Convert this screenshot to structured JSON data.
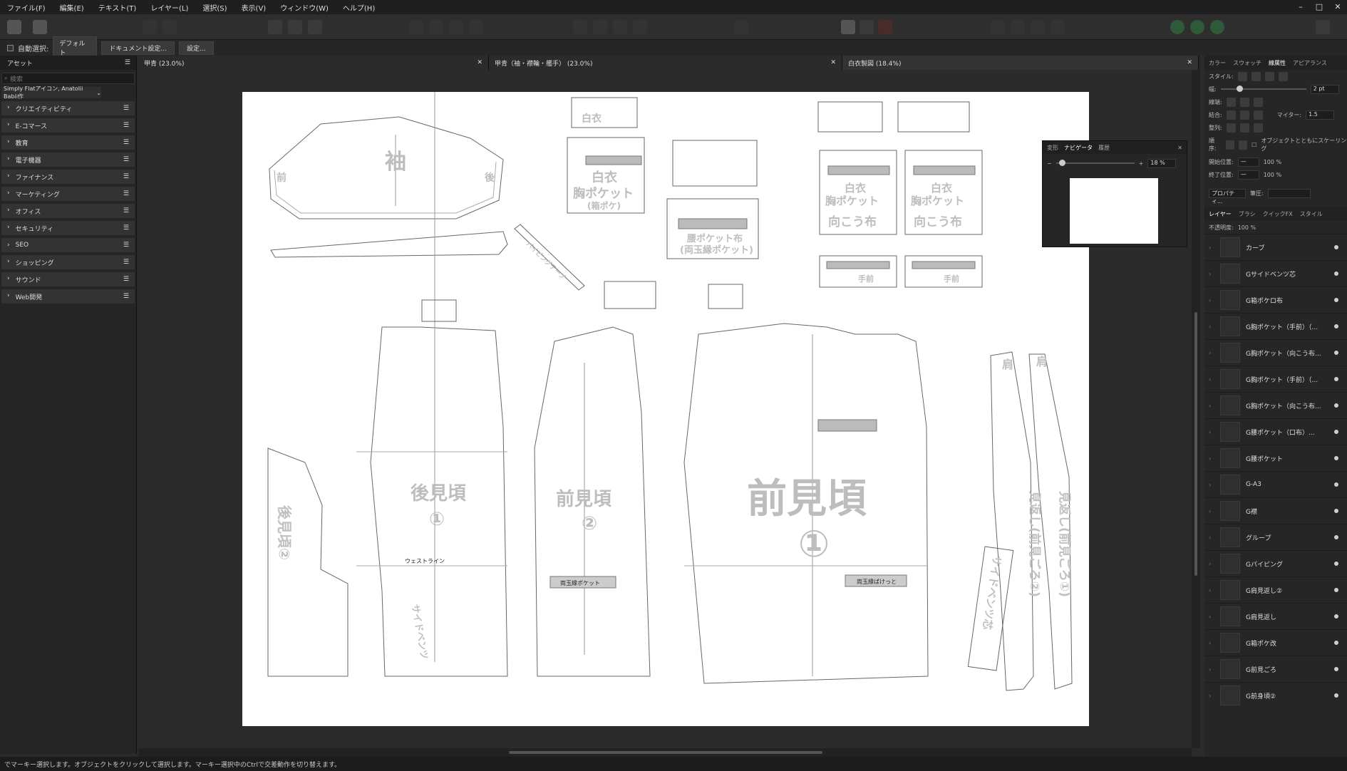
{
  "menu": [
    "ファイル(F)",
    "編集(E)",
    "テキスト(T)",
    "レイヤー(L)",
    "選択(S)",
    "表示(V)",
    "ウィンドウ(W)",
    "ヘルプ(H)"
  ],
  "context_bar": {
    "auto_select": "自動選択:",
    "auto_select_value": "デフォルト",
    "doc_settings": "ドキュメント設定...",
    "settings": "設定..."
  },
  "left_panel": {
    "tab": "アセット",
    "search_placeholder": "検索",
    "library": "Simply Flatアイコン, Anatolii Babii作",
    "categories": [
      "クリエイティビティ",
      "E-コマース",
      "教育",
      "電子機器",
      "ファイナンス",
      "マーケティング",
      "オフィス",
      "セキュリティ",
      "SEO",
      "ショッピング",
      "サウンド",
      "Web開発"
    ]
  },
  "doc_tabs": [
    {
      "label": "甲青 (23.0%)"
    },
    {
      "label": "甲青（袖・襟輪・艦手） (23.0%)"
    },
    {
      "label": "白衣製図 (18.4%)"
    }
  ],
  "navigator": {
    "tabs": [
      "変形",
      "ナビゲータ",
      "履歴"
    ],
    "zoom": "18 %"
  },
  "right_panel": {
    "tabs": [
      "カラー",
      "スウォッチ",
      "線属性",
      "アピアランス"
    ],
    "style_label": "スタイル:",
    "width_label": "幅:",
    "width_value": "2 pt",
    "cap_label": "線端:",
    "join_label": "結合:",
    "miter_label": "マイター:",
    "miter_value": "1.5",
    "align_label": "整列:",
    "order_label": "順序:",
    "scale_with_object": "オブジェクトとともにスケーリング",
    "start_label": "開始位置:",
    "end_label": "終了位置:",
    "pct1": "100 %",
    "pct2": "100 %",
    "properties_btn": "プロパティ...",
    "pressure_label": "筆圧:",
    "layer_tabs": [
      "レイヤー",
      "ブラシ",
      "クイックFX",
      "スタイル"
    ],
    "opacity_label": "不透明度:",
    "opacity_value": "100 %",
    "layers": [
      "カーブ",
      "Gサイドベンツ芯",
      "G箱ポケロ布",
      "G胸ポケット（手前）（...",
      "G胸ポケット（向こう布...",
      "G胸ポケット（手前）（...",
      "G胸ポケット（向こう布...",
      "G腰ポケット（口布）...",
      "G腰ポケット",
      "G-A3",
      "G襟",
      "グループ",
      "Gパイピング",
      "G肩見返し②",
      "G肩見返し",
      "G箱ポケ改",
      "G前見ごろ",
      "G前身頃②"
    ]
  },
  "pattern_labels": {
    "sleeve": "袖",
    "front": "前",
    "back": "後",
    "back_body": "後見頃",
    "back_body_num": "①",
    "front2": "前見頃",
    "front2_num": "②",
    "front1": "前見頃",
    "front1_num": "①",
    "waist": "ウェストライン",
    "double_pocket": "両玉縁ポケット",
    "double_pocket2": "両玉縁ぱけっと",
    "white_coat": "白衣",
    "chest_pocket": "胸ポケット",
    "box_pocket": "(箱ポケ)",
    "far_cloth": "向こう布",
    "near": "手前",
    "waist_pocket": "腰ポケット布",
    "waist_pocket2": "(両玉縁ポケット)",
    "facing1": "見返し(前見ごろ①)",
    "facing2": "見返し(前見ごろ②)",
    "side_vent": "サイドベンツ芯",
    "shoulder": "肩",
    "collar": "襟",
    "back_body_side": "後見頃②",
    "side_vent2": "サイドベンツ",
    "piping": "パイピングテープ"
  },
  "status": "でマーキー選択します。オブジェクトをクリックして選択します。マーキー選択中のCtrlで交差動作を切り替えます。"
}
